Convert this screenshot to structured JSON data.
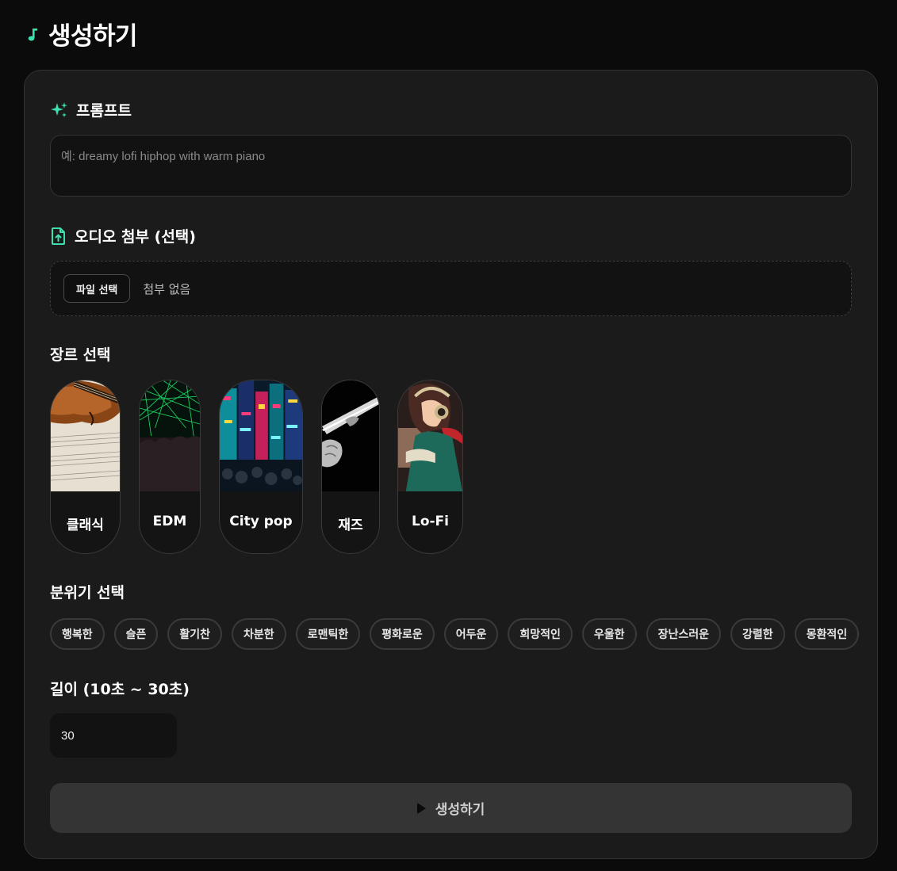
{
  "header": {
    "title": "생성하기",
    "accent_color": "#3fe0b0"
  },
  "prompt": {
    "label": "프롬프트",
    "placeholder": "예: dreamy lofi hiphop with warm piano"
  },
  "attachment": {
    "label": "오디오 첨부 (선택)",
    "button_label": "파일 선택",
    "status": "첨부 없음"
  },
  "genre": {
    "label": "장르 선택",
    "items": [
      {
        "label": "클래식",
        "image": "violin-sheet-music"
      },
      {
        "label": "EDM",
        "image": "green-laser-concert"
      },
      {
        "label": "City pop",
        "image": "neon-city-street"
      },
      {
        "label": "재즈",
        "image": "trumpet-hand"
      },
      {
        "label": "Lo-Fi",
        "image": "lofi-girl-headphones"
      }
    ]
  },
  "mood": {
    "label": "분위기 선택",
    "items": [
      "행복한",
      "슬픈",
      "활기찬",
      "차분한",
      "로맨틱한",
      "평화로운",
      "어두운",
      "희망적인",
      "우울한",
      "장난스러운",
      "강렬한",
      "몽환적인"
    ]
  },
  "length": {
    "label": "길이 (10초 ~ 30초)",
    "value": "30"
  },
  "generate": {
    "label": "생성하기"
  }
}
